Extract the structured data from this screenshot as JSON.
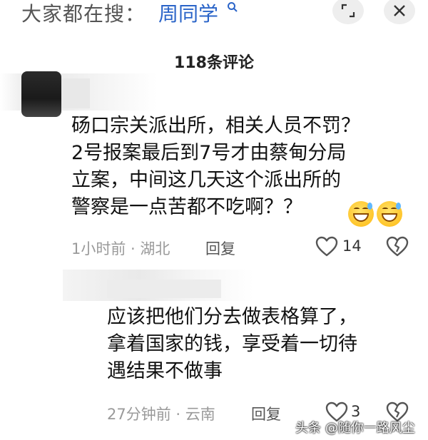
{
  "search": {
    "prefix": "大家都在搜：",
    "term": "周同学",
    "term_icon": "search-icon"
  },
  "top_actions": {
    "expand_icon": "expand-icon",
    "close_icon": "close-icon"
  },
  "comments_header": "118条评论",
  "comments": [
    {
      "text": "砀口宗关派出所，相关人员不罚？\n2号报案最后到7号才由蔡甸分局\n立案，中间这几天这个派出所的\n警察是一点苦都不吃啊？？",
      "emoji": [
        "grin-sweat-emoji",
        "grin-sweat-emoji"
      ],
      "meta": "1小时前 · 湖北",
      "reply_label": "回复",
      "likes": "14"
    },
    {
      "text": "应该把他们分去做表格算了，\n拿着国家的钱，享受着一切待\n遇结果不做事",
      "meta": "27分钟前 · 云南",
      "reply_label": "回复",
      "likes": "3"
    }
  ],
  "watermark": "头条 @随你一路风尘",
  "colors": {
    "accent": "#2a64c8",
    "meta_gray": "#9a9a9a",
    "icon_gray": "#555555"
  }
}
